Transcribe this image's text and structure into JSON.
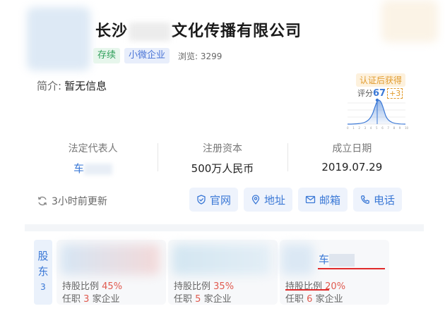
{
  "company": {
    "name_prefix": "长沙",
    "name_suffix": "文化传播有限公司",
    "tags": [
      "存续",
      "小微企业"
    ],
    "views_label": "浏览: 3299"
  },
  "intro": {
    "label": "简介:",
    "value": "暂无信息"
  },
  "score": {
    "badge": "认证后获得",
    "label": "评分",
    "value": "67",
    "bonus": "+3",
    "axis_ticks": [
      "0",
      "1",
      "2",
      "3",
      "4",
      "5",
      "6",
      "7",
      "8",
      "9",
      "10"
    ]
  },
  "stats": [
    {
      "label": "法定代表人",
      "value": "车"
    },
    {
      "label": "注册资本",
      "value": "500万人民币"
    },
    {
      "label": "成立日期",
      "value": "2019.07.29"
    }
  ],
  "update_text": "3小时前更新",
  "actions": [
    {
      "label": "官网",
      "icon": "shield-check-icon"
    },
    {
      "label": "地址",
      "icon": "location-pin-icon"
    },
    {
      "label": "邮箱",
      "icon": "mail-icon"
    },
    {
      "label": "电话",
      "icon": "phone-icon"
    }
  ],
  "shareholders": {
    "tab_label_1": "股",
    "tab_label_2": "东",
    "count": "3",
    "cards": [
      {
        "name": "",
        "share_label": "持股比例",
        "share": "45%",
        "post_label": "任职",
        "companies": "3",
        "companies_suffix": "家企业"
      },
      {
        "name": "",
        "share_label": "持股比例",
        "share": "35%",
        "post_label": "任职",
        "companies": "5",
        "companies_suffix": "家企业"
      },
      {
        "name": "车",
        "share_label": "持股比例",
        "share": "20%",
        "post_label": "任职",
        "companies": "6",
        "companies_suffix": "家企业"
      }
    ]
  },
  "colors": {
    "accent": "#3a78d6",
    "danger": "#e05a4f",
    "annotation": "#e02a2a"
  }
}
